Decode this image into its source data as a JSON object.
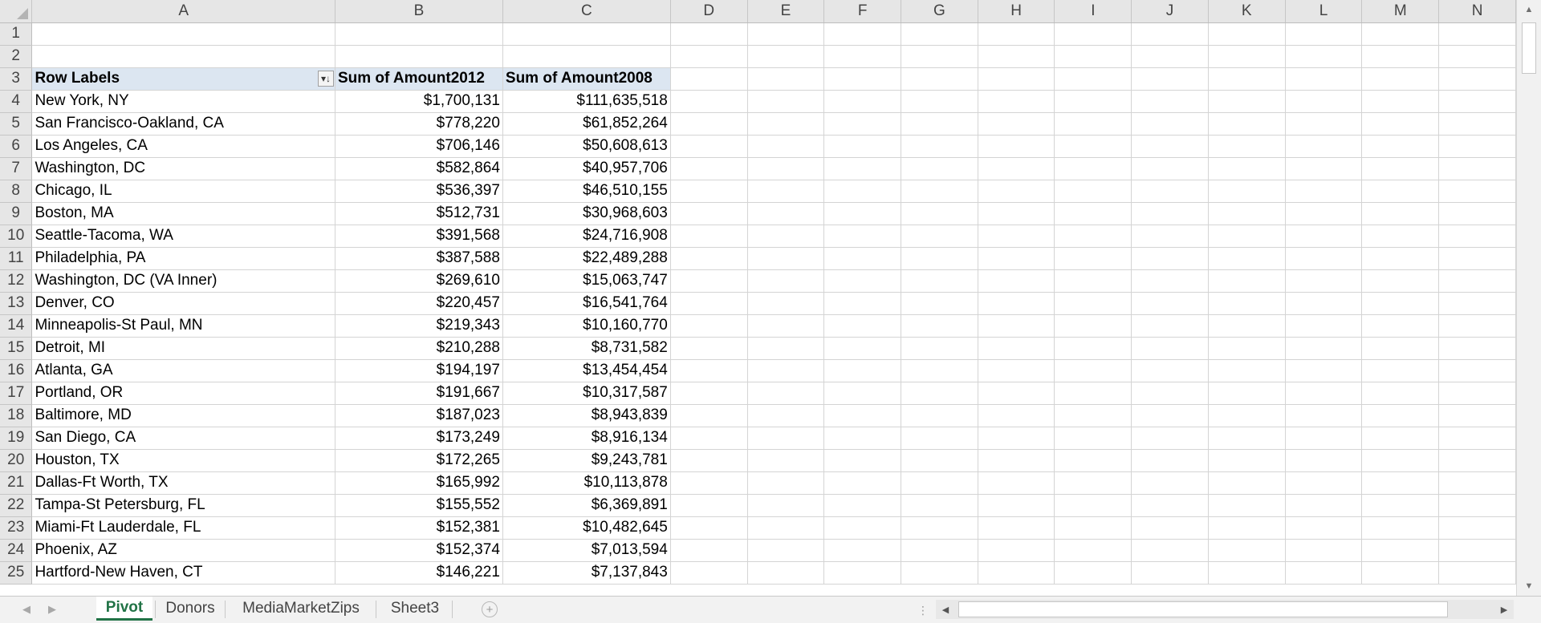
{
  "columns": [
    "A",
    "B",
    "C",
    "D",
    "E",
    "F",
    "G",
    "H",
    "I",
    "J",
    "K",
    "L",
    "M",
    "N"
  ],
  "empty_rows": [
    "1",
    "2"
  ],
  "pivot_header": {
    "row_num": "3",
    "row_labels": "Row Labels",
    "col_b": "Sum of Amount2012",
    "col_c": "Sum of Amount2008",
    "filter_icon": "sort-filter-dropdown-icon"
  },
  "rows": [
    {
      "num": "4",
      "label": "New York, NY",
      "b": "$1,700,131",
      "c": "$111,635,518"
    },
    {
      "num": "5",
      "label": "San Francisco-Oakland, CA",
      "b": "$778,220",
      "c": "$61,852,264"
    },
    {
      "num": "6",
      "label": "Los Angeles, CA",
      "b": "$706,146",
      "c": "$50,608,613"
    },
    {
      "num": "7",
      "label": "Washington, DC",
      "b": "$582,864",
      "c": "$40,957,706"
    },
    {
      "num": "8",
      "label": "Chicago, IL",
      "b": "$536,397",
      "c": "$46,510,155"
    },
    {
      "num": "9",
      "label": "Boston, MA",
      "b": "$512,731",
      "c": "$30,968,603"
    },
    {
      "num": "10",
      "label": "Seattle-Tacoma, WA",
      "b": "$391,568",
      "c": "$24,716,908"
    },
    {
      "num": "11",
      "label": "Philadelphia, PA",
      "b": "$387,588",
      "c": "$22,489,288"
    },
    {
      "num": "12",
      "label": "Washington, DC (VA Inner)",
      "b": "$269,610",
      "c": "$15,063,747"
    },
    {
      "num": "13",
      "label": "Denver, CO",
      "b": "$220,457",
      "c": "$16,541,764"
    },
    {
      "num": "14",
      "label": "Minneapolis-St Paul, MN",
      "b": "$219,343",
      "c": "$10,160,770"
    },
    {
      "num": "15",
      "label": "Detroit, MI",
      "b": "$210,288",
      "c": "$8,731,582"
    },
    {
      "num": "16",
      "label": "Atlanta, GA",
      "b": "$194,197",
      "c": "$13,454,454"
    },
    {
      "num": "17",
      "label": "Portland, OR",
      "b": "$191,667",
      "c": "$10,317,587"
    },
    {
      "num": "18",
      "label": "Baltimore, MD",
      "b": "$187,023",
      "c": "$8,943,839"
    },
    {
      "num": "19",
      "label": "San Diego, CA",
      "b": "$173,249",
      "c": "$8,916,134"
    },
    {
      "num": "20",
      "label": "Houston, TX",
      "b": "$172,265",
      "c": "$9,243,781"
    },
    {
      "num": "21",
      "label": "Dallas-Ft Worth, TX",
      "b": "$165,992",
      "c": "$10,113,878"
    },
    {
      "num": "22",
      "label": "Tampa-St Petersburg, FL",
      "b": "$155,552",
      "c": "$6,369,891"
    },
    {
      "num": "23",
      "label": "Miami-Ft Lauderdale, FL",
      "b": "$152,381",
      "c": "$10,482,645"
    },
    {
      "num": "24",
      "label": "Phoenix, AZ",
      "b": "$152,374",
      "c": "$7,013,594"
    },
    {
      "num": "25",
      "label": "Hartford-New Haven, CT",
      "b": "$146,221",
      "c": "$7,137,843"
    }
  ],
  "sheet_tabs": [
    "Pivot",
    "Donors",
    "MediaMarketZips",
    "Sheet3"
  ],
  "active_tab": "Pivot",
  "colors": {
    "header_bg": "#e6e6e6",
    "pivot_header_bg": "#dce6f1",
    "active_tab_text": "#217346",
    "gridline": "#d4d4d4"
  },
  "icons": {
    "corner": "select-all-triangle-icon",
    "scroll_up": "scroll-up-arrow-icon",
    "scroll_down": "scroll-down-arrow-icon",
    "scroll_left": "scroll-left-arrow-icon",
    "scroll_right": "scroll-right-arrow-icon",
    "tab_prev": "tab-prev-arrow-icon",
    "tab_next": "tab-next-arrow-icon",
    "add_sheet": "plus-circle-icon"
  }
}
